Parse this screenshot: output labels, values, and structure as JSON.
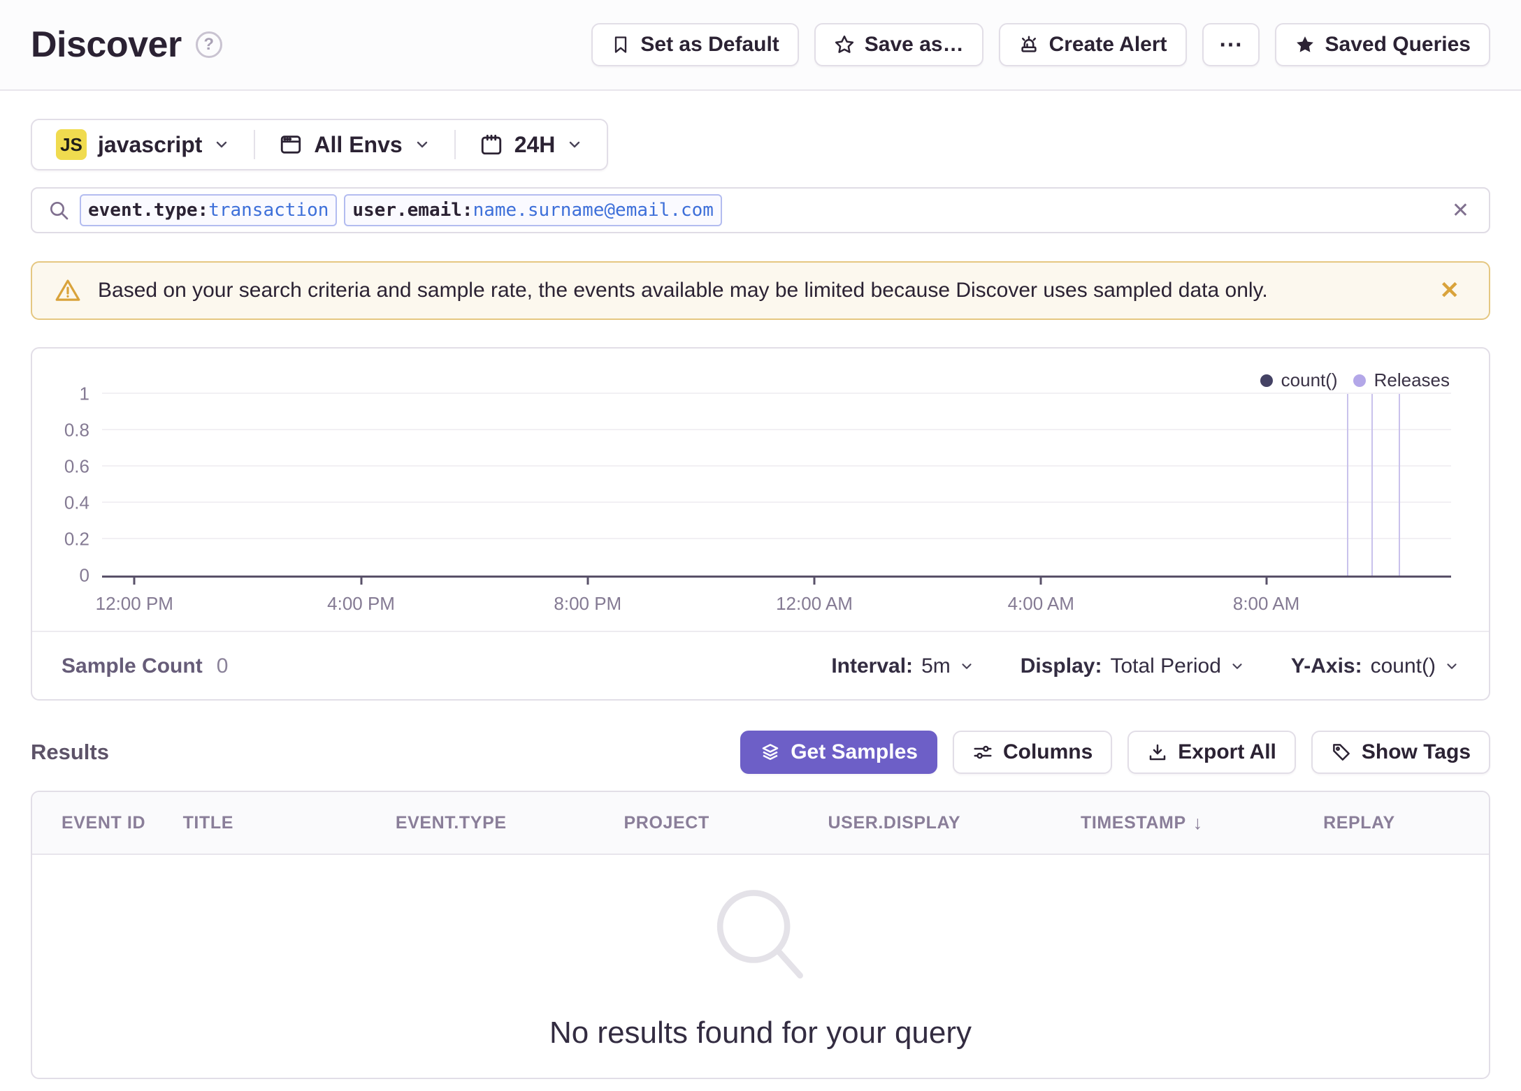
{
  "icons": {
    "question": "?",
    "close": "✕",
    "sort_desc": "↓",
    "ellipsis": "⋯"
  },
  "colors": {
    "primary_purple": "#6D5FC7",
    "js_badge_yellow": "#F0DB4F",
    "token_value_blue": "#3D6FD9",
    "warning_gold": "#D9A33B",
    "banner_bg": "#FCF8EE",
    "count_series": "#444264",
    "releases_line": "#C9C2EC"
  },
  "header": {
    "title": "Discover",
    "actions": [
      {
        "label": "Set as Default",
        "icon": "bookmark-icon"
      },
      {
        "label": "Save as…",
        "icon": "star-outline-icon"
      },
      {
        "label": "Create Alert",
        "icon": "siren-icon"
      },
      {
        "label": "⋯",
        "icon": "ellipsis-icon"
      },
      {
        "label": "Saved Queries",
        "icon": "star-filled-icon"
      }
    ]
  },
  "filters": {
    "project": {
      "badge": "JS",
      "label": "javascript"
    },
    "environment": {
      "label": "All Envs"
    },
    "time_range": {
      "label": "24H"
    }
  },
  "search": {
    "tokens": [
      {
        "key": "event.type:",
        "value": "transaction"
      },
      {
        "key": "user.email:",
        "value": "name.surname@email.com"
      }
    ]
  },
  "banner": {
    "message": "Based on your search criteria and sample rate, the events available may be limited because Discover uses sampled data only."
  },
  "chart_data": {
    "type": "line",
    "title": "",
    "xlabel": "",
    "ylabel": "",
    "ylim": [
      0,
      1
    ],
    "y_ticks": [
      0,
      0.2,
      0.4,
      0.6,
      0.8,
      1
    ],
    "x_ticks": [
      {
        "label": "12:00 PM",
        "pos_pct": 2.4
      },
      {
        "label": "4:00 PM",
        "pos_pct": 19.2
      },
      {
        "label": "8:00 PM",
        "pos_pct": 36.0
      },
      {
        "label": "12:00 AM",
        "pos_pct": 52.8
      },
      {
        "label": "4:00 AM",
        "pos_pct": 69.6
      },
      {
        "label": "8:00 AM",
        "pos_pct": 86.3
      }
    ],
    "series": [
      {
        "name": "count()",
        "color": "#444264",
        "values": []
      }
    ],
    "releases": {
      "name": "Releases",
      "color": "#C9C2EC",
      "positions_pct": [
        92.3,
        94.1,
        96.1
      ]
    },
    "grid": true,
    "legend_position": "top-right"
  },
  "chart_footer": {
    "sample_count_label": "Sample Count",
    "sample_count_value": "0",
    "controls": [
      {
        "label": "Interval:",
        "value": "5m"
      },
      {
        "label": "Display:",
        "value": "Total Period"
      },
      {
        "label": "Y-Axis:",
        "value": "count()"
      }
    ]
  },
  "results": {
    "title": "Results",
    "buttons": [
      {
        "label": "Get Samples",
        "primary": true
      },
      {
        "label": "Columns"
      },
      {
        "label": "Export All"
      },
      {
        "label": "Show Tags"
      }
    ]
  },
  "results_table": {
    "columns": [
      {
        "label": "EVENT ID"
      },
      {
        "label": "TITLE"
      },
      {
        "label": "EVENT.TYPE"
      },
      {
        "label": "PROJECT"
      },
      {
        "label": "USER.DISPLAY"
      },
      {
        "label": "TIMESTAMP",
        "sort": "desc"
      },
      {
        "label": "REPLAY"
      }
    ],
    "rows": [],
    "empty_state": "No results found for your query"
  }
}
